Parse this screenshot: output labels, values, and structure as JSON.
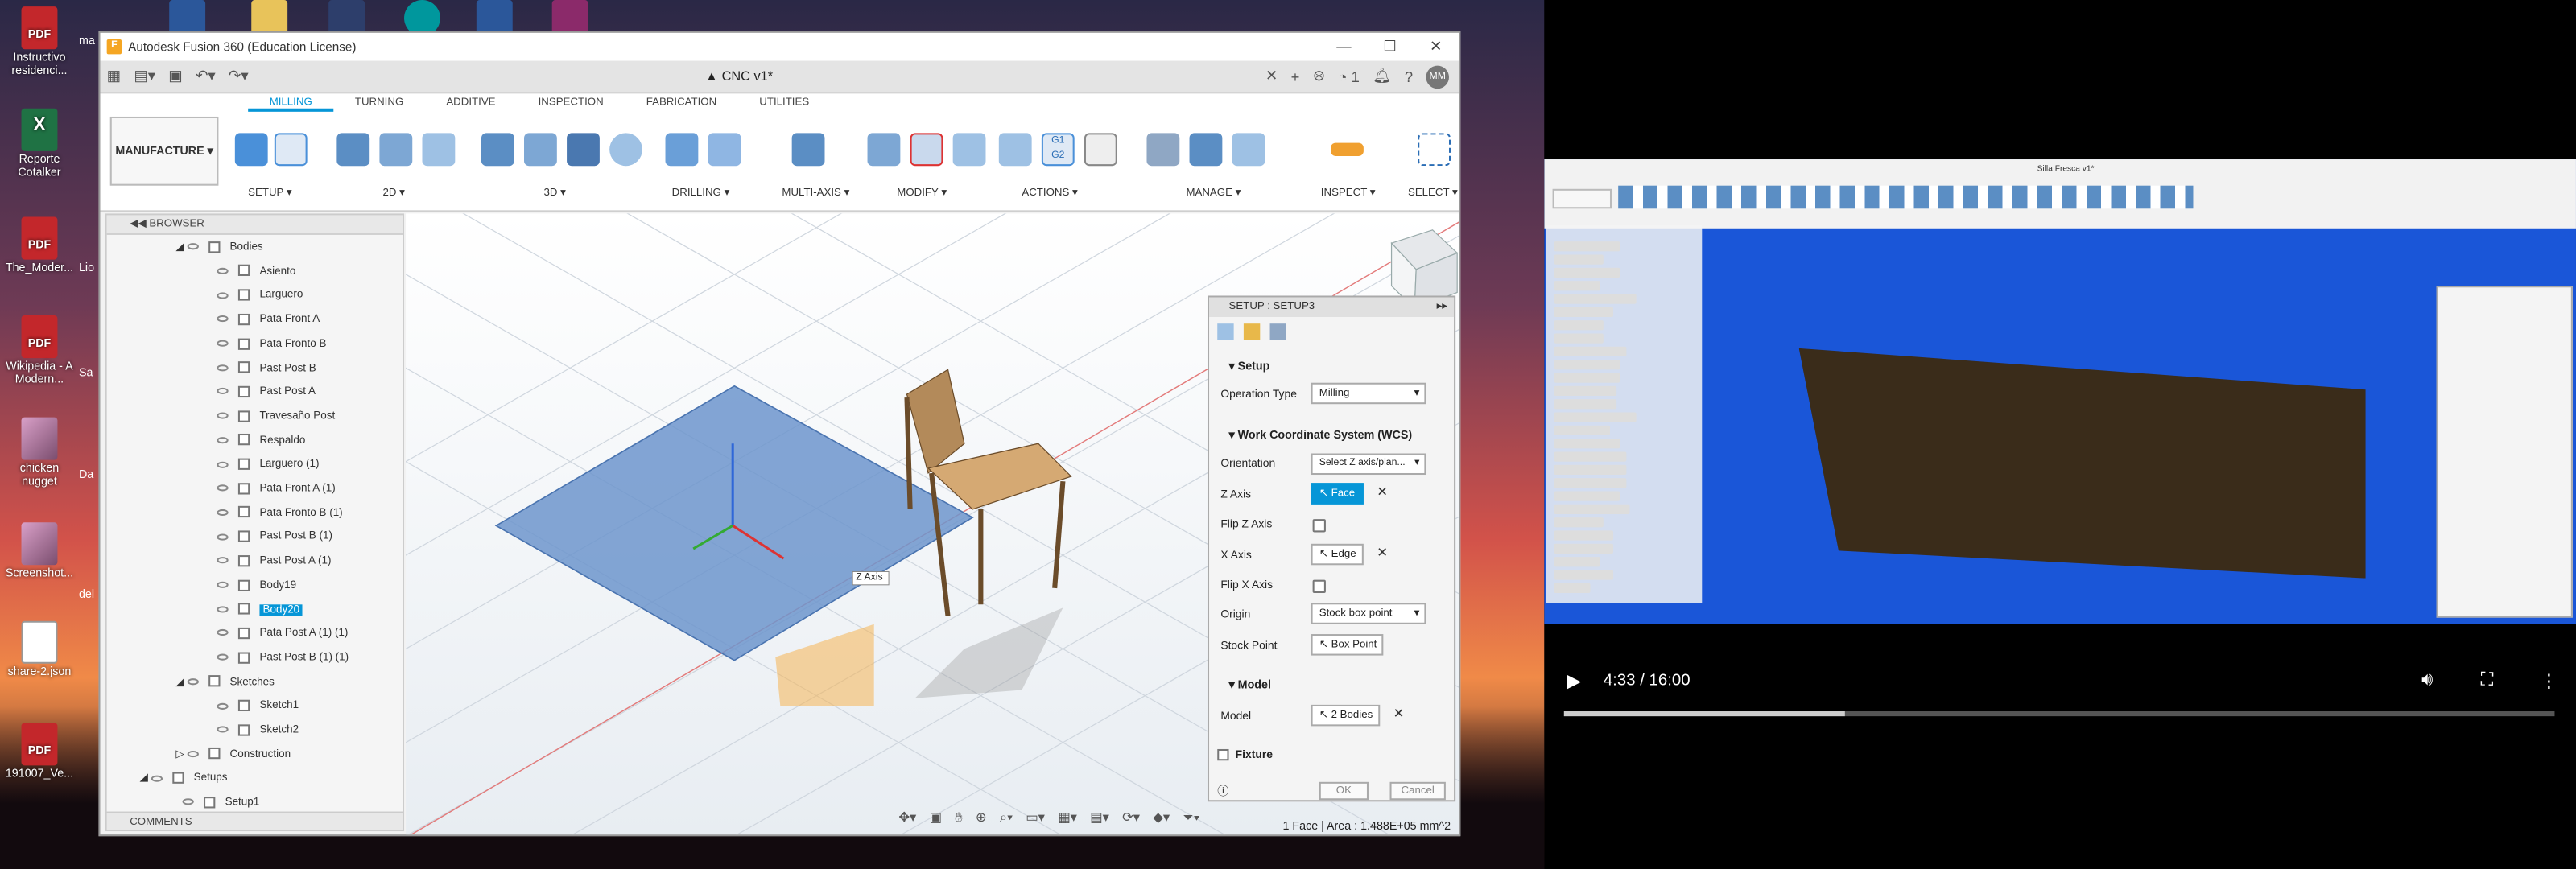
{
  "desktop": {
    "icons": [
      {
        "label": "Instructivo residenci...",
        "type": "pdf"
      },
      {
        "label": "Reporte Cotalker",
        "type": "xl"
      },
      {
        "label": "The_Moder...",
        "type": "pdf"
      },
      {
        "label": "Wikipedia - A Modern...",
        "type": "pdf"
      },
      {
        "label": "chicken nugget",
        "type": "img"
      },
      {
        "label": "Screenshot...",
        "type": "img"
      },
      {
        "label": "share-2.json",
        "type": "doc"
      },
      {
        "label": "191007_Ve...",
        "type": "pdf"
      }
    ],
    "partial_labels": [
      "ma",
      "Lio",
      "Sa",
      "Da",
      "del"
    ]
  },
  "fusion": {
    "title": "Autodesk Fusion 360 (Education License)",
    "doc_tab": "CNC v1*",
    "notif_count": "1",
    "avatar_initials": "MM",
    "workspace": "MANUFACTURE",
    "ribbon_tabs": [
      "MILLING",
      "TURNING",
      "ADDITIVE",
      "INSPECTION",
      "FABRICATION",
      "UTILITIES"
    ],
    "active_tab": "MILLING",
    "groups": [
      "SETUP",
      "2D",
      "3D",
      "DRILLING",
      "MULTI-AXIS",
      "MODIFY",
      "ACTIONS",
      "MANAGE",
      "INSPECT",
      "SELECT"
    ],
    "browser": {
      "header": "BROWSER",
      "bodies_label": "Bodies",
      "items": [
        "Asiento",
        "Larguero",
        "Pata Front A",
        "Pata Fronto B",
        "Past Post B",
        "Past Post A",
        "Travesaño Post",
        "Respaldo",
        "Larguero (1)",
        "Pata Front A (1)",
        "Pata Fronto B (1)",
        "Past Post B (1)",
        "Past Post A (1)",
        "Body19",
        "Body20",
        "Pata Post A (1) (1)",
        "Past Post B (1) (1)"
      ],
      "selected": "Body20",
      "sketches_label": "Sketches",
      "sketches": [
        "Sketch1",
        "Sketch2"
      ],
      "construction": "Construction",
      "setups": "Setups",
      "setup1": "Setup1"
    },
    "comments": "COMMENTS",
    "viewport_label": "Z Axis",
    "status": "1 Face | Area : 1.488E+05 mm^2",
    "setup_dialog": {
      "header": "SETUP : SETUP3",
      "section_setup": "Setup",
      "operation_type_label": "Operation Type",
      "operation_type": "Milling",
      "section_wcs": "Work Coordinate System (WCS)",
      "orientation_label": "Orientation",
      "orientation": "Select Z axis/plan...",
      "z_axis_label": "Z Axis",
      "z_axis": "Face",
      "flip_z_label": "Flip Z Axis",
      "x_axis_label": "X Axis",
      "x_axis": "Edge",
      "flip_x_label": "Flip X Axis",
      "origin_label": "Origin",
      "origin": "Stock box point",
      "stock_point_label": "Stock Point",
      "stock_point": "Box Point",
      "section_model": "Model",
      "model_label": "Model",
      "model": "2 Bodies",
      "section_fixture": "Fixture",
      "ok": "OK",
      "cancel": "Cancel"
    }
  },
  "video": {
    "time": "4:33 / 16:00",
    "progress": 0.284,
    "doc_title": "Silla Fresca v1*"
  }
}
